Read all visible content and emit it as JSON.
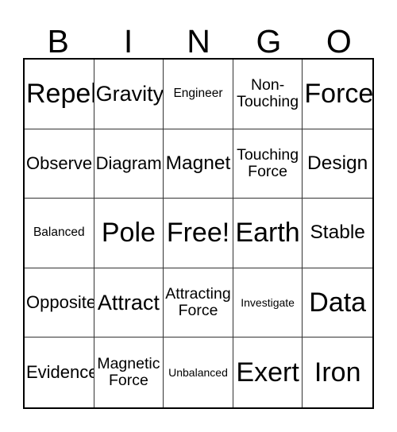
{
  "card": {
    "title": "BINGO",
    "header_letters": [
      "B",
      "I",
      "N",
      "G",
      "O"
    ],
    "grid_size": "5x5",
    "free_space_label": "Free!",
    "colors": {
      "background": "#ffffff",
      "text": "#000000",
      "outer_border": "#000000",
      "inner_border": "#333333"
    },
    "rows": [
      {
        "cells": [
          {
            "text": "Repel",
            "size": "fs-3xl"
          },
          {
            "text": "Gravity",
            "size": "fs-2xl"
          },
          {
            "text": "Engineer",
            "size": "fs-sm"
          },
          {
            "text": "Non-\nTouching",
            "size": "fs-md"
          },
          {
            "text": "Force",
            "size": "fs-3xl"
          }
        ]
      },
      {
        "cells": [
          {
            "text": "Observe",
            "size": "fs-lg"
          },
          {
            "text": "Diagram",
            "size": "fs-lg"
          },
          {
            "text": "Magnet",
            "size": "fs-xl"
          },
          {
            "text": "Touching\nForce",
            "size": "fs-md"
          },
          {
            "text": "Design",
            "size": "fs-xl"
          }
        ]
      },
      {
        "cells": [
          {
            "text": "Balanced",
            "size": "fs-sm"
          },
          {
            "text": "Pole",
            "size": "fs-3xl"
          },
          {
            "text": "Free!",
            "size": "fs-3xl"
          },
          {
            "text": "Earth",
            "size": "fs-3xl"
          },
          {
            "text": "Stable",
            "size": "fs-xl"
          }
        ]
      },
      {
        "cells": [
          {
            "text": "Opposite",
            "size": "fs-lg"
          },
          {
            "text": "Attract",
            "size": "fs-2xl"
          },
          {
            "text": "Attracting\nForce",
            "size": "fs-md"
          },
          {
            "text": "Investigate",
            "size": "fs-xs"
          },
          {
            "text": "Data",
            "size": "fs-3xl"
          }
        ]
      },
      {
        "cells": [
          {
            "text": "Evidence",
            "size": "fs-lg"
          },
          {
            "text": "Magnetic\nForce",
            "size": "fs-md"
          },
          {
            "text": "Unbalanced",
            "size": "fs-xs"
          },
          {
            "text": "Exert",
            "size": "fs-3xl"
          },
          {
            "text": "Iron",
            "size": "fs-3xl"
          }
        ]
      }
    ]
  }
}
